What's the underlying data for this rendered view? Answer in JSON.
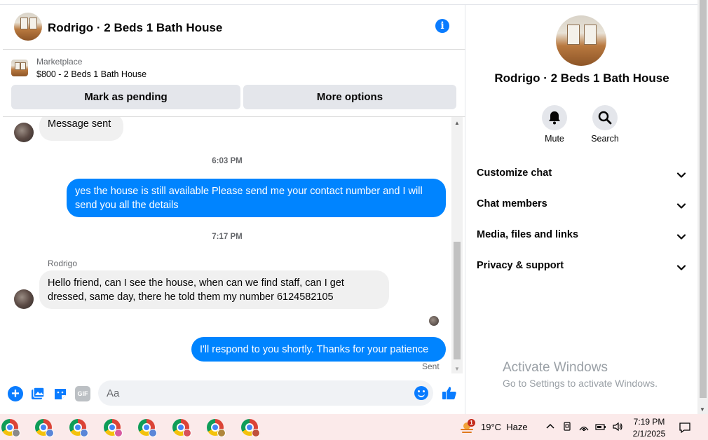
{
  "header": {
    "title": "Rodrigo · 2 Beds 1 Bath House"
  },
  "marketplace": {
    "source": "Marketplace",
    "listing": "$800 - 2 Beds 1 Bath House",
    "pending_button": "Mark as pending",
    "options_button": "More options"
  },
  "messages": {
    "first_in": "Message sent",
    "time1": "6:03 PM",
    "out1": "yes the house is still available Please send me your contact number and I will send you all the details",
    "time2": "7:17 PM",
    "sender": "Rodrigo",
    "in2": "Hello friend, can I see the house, when can we find staff, can I get dressed, same day, there he told them my number 6124582105",
    "out2": "I'll respond to you shortly. Thanks for your patience",
    "status": "Sent"
  },
  "composer": {
    "placeholder": "Aa",
    "gif_label": "GIF"
  },
  "info": {
    "title": "Rodrigo · 2 Beds 1 Bath House",
    "mute_label": "Mute",
    "search_label": "Search",
    "sections": [
      "Customize chat",
      "Chat members",
      "Media, files and links",
      "Privacy & support"
    ]
  },
  "watermark": {
    "line1": "Activate Windows",
    "line2": "Go to Settings to activate Windows."
  },
  "taskbar": {
    "weather": "19°C  Haze",
    "weather_badge": "1",
    "time": "7:19 PM",
    "date": "2/1/2025"
  },
  "colors": {
    "accent": "#0084ff",
    "bubble_in": "#f0f0f0",
    "taskbar_bg": "#fbeaea"
  }
}
